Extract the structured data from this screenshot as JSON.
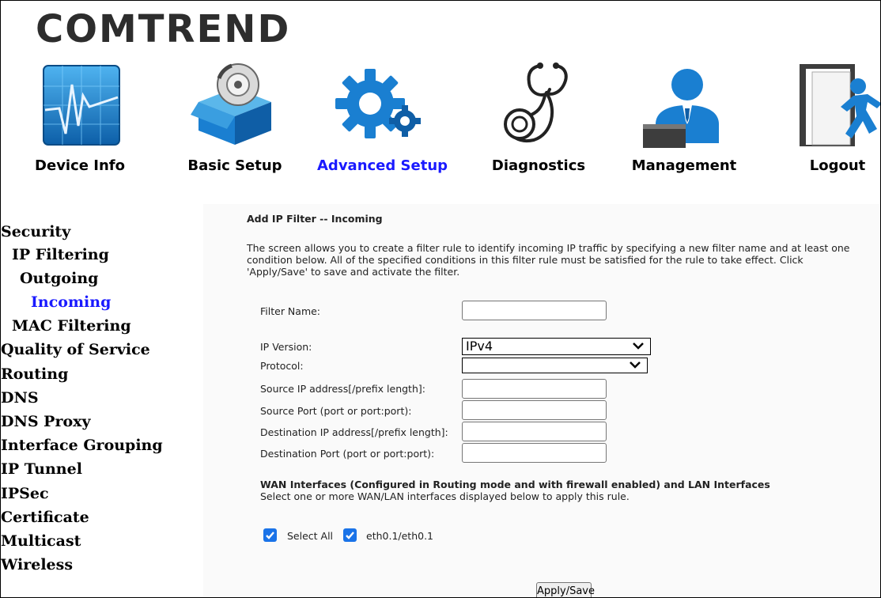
{
  "brand": "COMTREND",
  "nav": {
    "device_info": "Device Info",
    "basic_setup": "Basic Setup",
    "advanced_setup": "Advanced Setup",
    "diagnostics": "Diagnostics",
    "management": "Management",
    "logout": "Logout"
  },
  "sidebar": {
    "security": "Security",
    "ip_filtering": "IP Filtering",
    "outgoing": "Outgoing",
    "incoming": "Incoming",
    "mac_filtering": "MAC Filtering",
    "qos": "Quality of Service",
    "routing": "Routing",
    "dns": "DNS",
    "dns_proxy": "DNS Proxy",
    "interface_grouping": "Interface Grouping",
    "ip_tunnel": "IP Tunnel",
    "ipsec": "IPSec",
    "certificate": "Certificate",
    "multicast": "Multicast",
    "wireless": "Wireless"
  },
  "form": {
    "heading": "Add IP Filter -- Incoming",
    "description": "The screen allows you to create a filter rule to identify incoming IP traffic by specifying a new filter name and at least one condition below. All of the specified conditions in this filter rule must be satisfied for the rule to take effect. Click 'Apply/Save' to save and activate the filter.",
    "filter_name_label": "Filter Name:",
    "filter_name_value": "",
    "ip_version_label": "IP Version:",
    "ip_version_value": "IPv4",
    "protocol_label": "Protocol:",
    "protocol_value": "",
    "src_ip_label": "Source IP address[/prefix length]:",
    "src_ip_value": "",
    "src_port_label": "Source Port (port or port:port):",
    "src_port_value": "",
    "dst_ip_label": "Destination IP address[/prefix length]:",
    "dst_ip_value": "",
    "dst_port_label": "Destination Port (port or port:port):",
    "dst_port_value": "",
    "wan_heading": "WAN Interfaces (Configured in Routing mode and with firewall enabled) and LAN Interfaces",
    "wan_desc": "Select one or more WAN/LAN interfaces displayed below to apply this rule.",
    "select_all_label": "Select All",
    "select_all_checked": true,
    "iface_label": "eth0.1/eth0.1",
    "iface_checked": true,
    "apply_button": "Apply/Save"
  },
  "colors": {
    "active_link": "#1a1aff",
    "checkbox": "#1a73e8",
    "icon_blue": "#1a7fd1"
  }
}
